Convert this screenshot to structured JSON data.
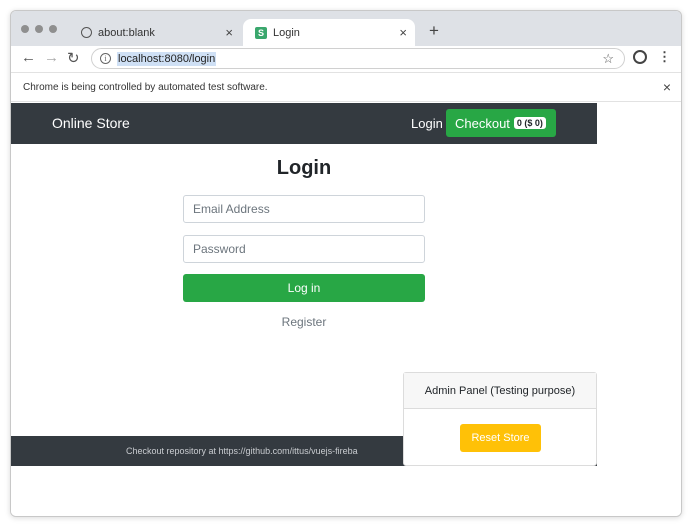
{
  "browser": {
    "tabs": [
      {
        "title": "about:blank",
        "icon": "globe-icon"
      },
      {
        "title": "Login",
        "icon": "s-favicon-icon",
        "favicon_letter": "S"
      }
    ],
    "new_tab_symbol": "+",
    "close_symbol": "×",
    "url": "localhost:8080/login",
    "infobar_text": "Chrome is being controlled by automated test software."
  },
  "navbar": {
    "brand": "Online Store",
    "login_link": "Login",
    "checkout_label": "Checkout",
    "cart_badge": "0 ($ 0)"
  },
  "login_form": {
    "title": "Login",
    "email_placeholder": "Email Address",
    "password_placeholder": "Password",
    "submit_label": "Log in",
    "register_link": "Register"
  },
  "footer": {
    "text": "Checkout repository at https://github.com/ittus/vuejs-fireba"
  },
  "admin_panel": {
    "title": "Admin Panel (Testing purpose)",
    "reset_label": "Reset Store"
  },
  "colors": {
    "navbar_bg": "#343a40",
    "success": "#28a745",
    "warning": "#ffc107"
  }
}
